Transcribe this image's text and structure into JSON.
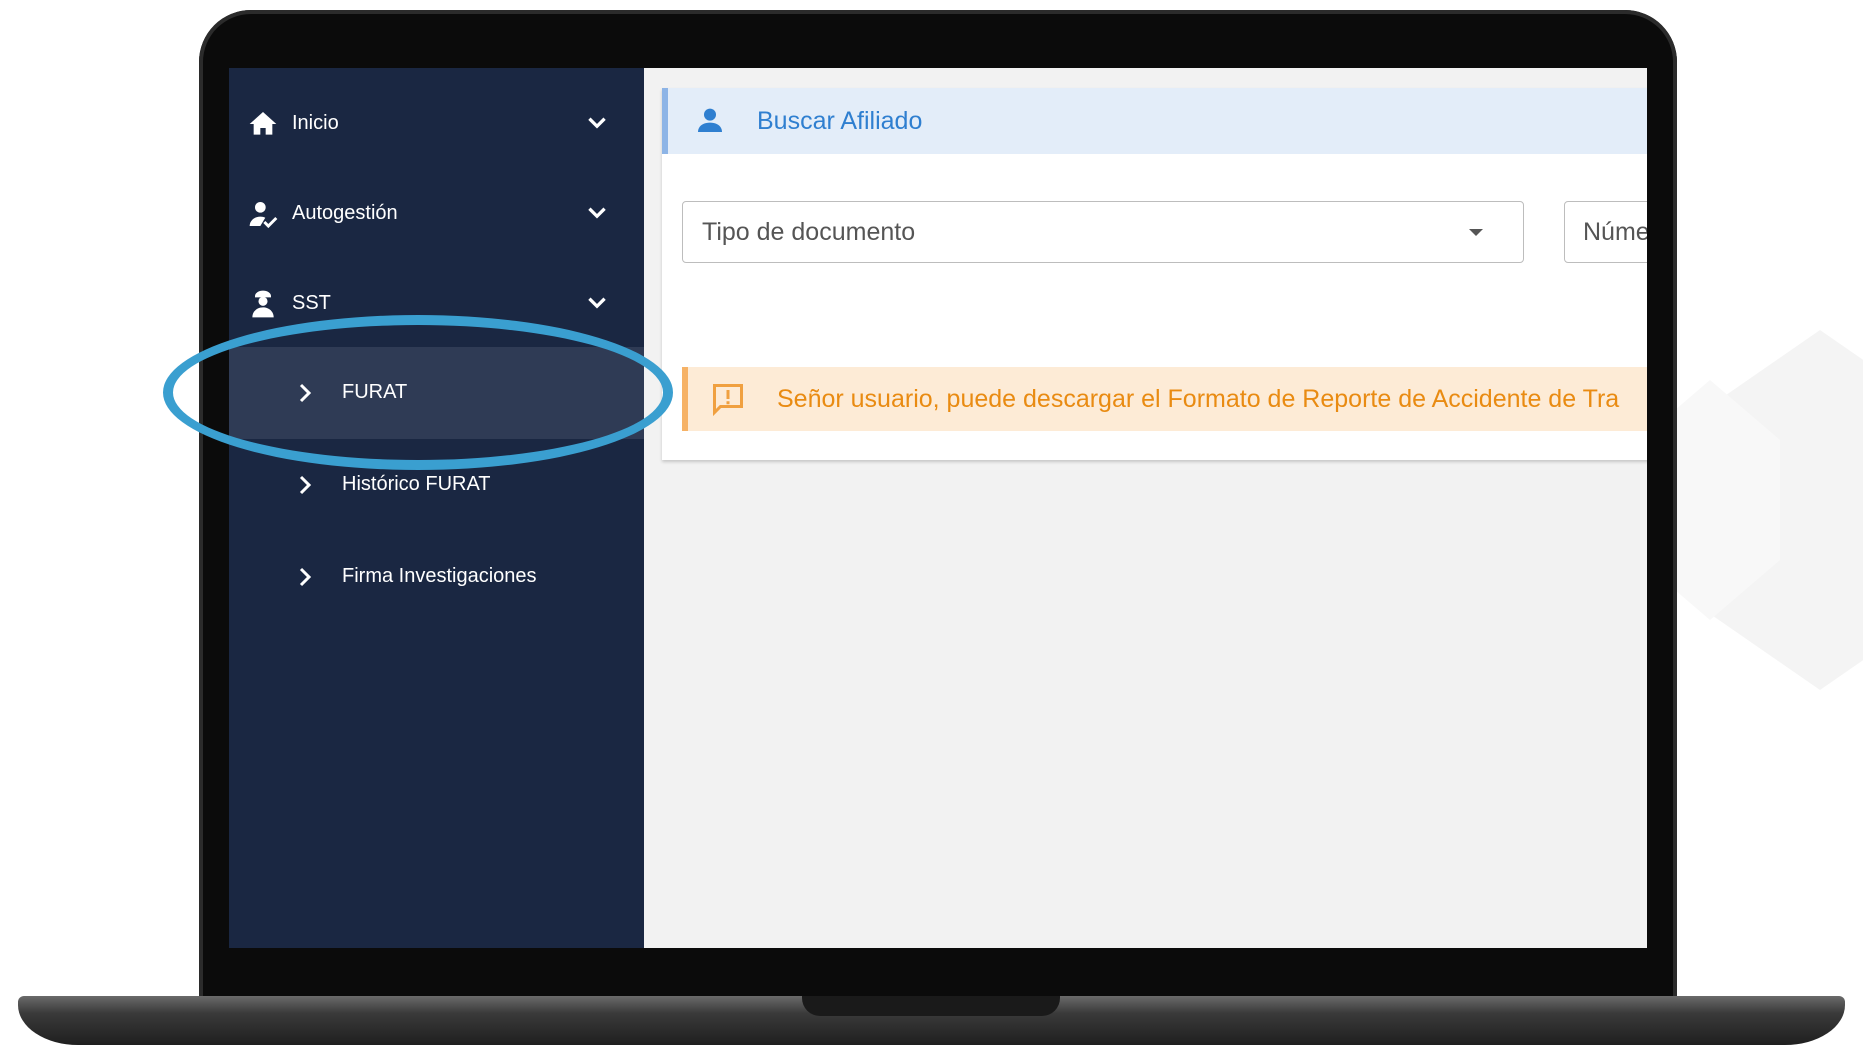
{
  "sidebar": {
    "items": [
      {
        "label": "Inicio",
        "icon": "home-icon"
      },
      {
        "label": "Autogestión",
        "icon": "user-check-icon"
      },
      {
        "label": "SST",
        "icon": "worker-icon"
      }
    ],
    "sub_items": [
      {
        "label": "FURAT",
        "active": true
      },
      {
        "label": "Histórico FURAT",
        "active": false
      },
      {
        "label": "Firma Investigaciones",
        "active": false
      }
    ]
  },
  "main": {
    "header": {
      "title": "Buscar Afiliado",
      "icon": "person-icon"
    },
    "tipo_documento": {
      "placeholder": "Tipo de documento"
    },
    "numero": {
      "placeholder": "Núme"
    },
    "alert": {
      "text": "Señor usuario, puede descargar el Formato de Reporte de Accidente de Tra",
      "icon": "alert-message-icon"
    }
  },
  "colors": {
    "sidebar_bg": "#1a2742",
    "active_item_bg": "#2f3b55",
    "header_bg": "#e3edf9",
    "header_text": "#2f7fd0",
    "alert_bg": "#fdebd6",
    "alert_text": "#e98b12",
    "highlight": "#3a9fd0"
  }
}
